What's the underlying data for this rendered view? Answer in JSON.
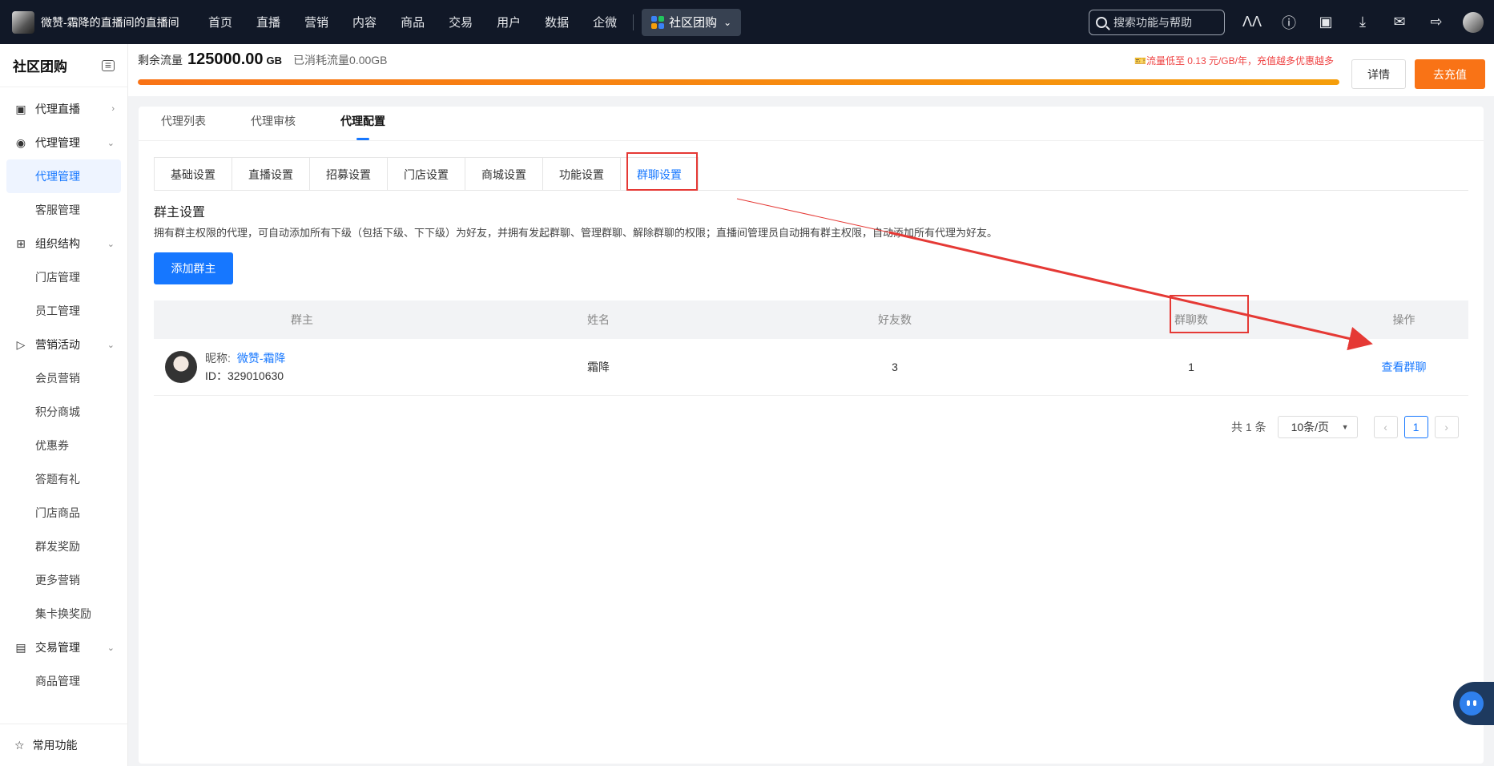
{
  "topbar": {
    "brand_name": "微赞-霜降的直播间的直播间",
    "nav": [
      "首页",
      "直播",
      "营销",
      "内容",
      "商品",
      "交易",
      "用户",
      "数据",
      "企微"
    ],
    "app_switch_label": "社区团购",
    "search_placeholder": "搜索功能与帮助"
  },
  "sidebar": {
    "title": "社区团购",
    "groups": [
      {
        "label": "代理直播",
        "icon": "calendar-icon",
        "arrow": "›",
        "items": []
      },
      {
        "label": "代理管理",
        "icon": "agent-icon",
        "arrow": "⌄",
        "items": [
          "代理管理",
          "客服管理"
        ]
      },
      {
        "label": "组织结构",
        "icon": "grid-icon",
        "arrow": "⌄",
        "items": [
          "门店管理",
          "员工管理"
        ]
      },
      {
        "label": "营销活动",
        "icon": "megaphone-icon",
        "arrow": "⌄",
        "items": [
          "会员营销",
          "积分商城",
          "优惠券",
          "答题有礼",
          "门店商品",
          "群发奖励",
          "更多营销",
          "集卡换奖励"
        ]
      },
      {
        "label": "交易管理",
        "icon": "wallet-icon",
        "arrow": "⌄",
        "items": [
          "商品管理"
        ]
      }
    ],
    "active_item": "代理管理",
    "footer_label": "常用功能"
  },
  "flow": {
    "label": "剩余流量",
    "value": "125000.00",
    "unit": "GB",
    "used": "已消耗流量0.00GB",
    "progress_percent": 100,
    "promo": "流量低至 0.13 元/GB/年，充值越多优惠越多",
    "detail_label": "详情",
    "recharge_label": "去充值"
  },
  "tabs": [
    "代理列表",
    "代理审核",
    "代理配置"
  ],
  "active_tab": "代理配置",
  "subtabs": [
    "基础设置",
    "直播设置",
    "招募设置",
    "门店设置",
    "商城设置",
    "功能设置",
    "群聊设置"
  ],
  "active_subtab": "群聊设置",
  "section": {
    "title": "群主设置",
    "desc": "拥有群主权限的代理，可自动添加所有下级（包括下级、下下级）为好友，并拥有发起群聊、管理群聊、解除群聊的权限；直播间管理员自动拥有群主权限，自动添加所有代理为好友。",
    "add_button": "添加群主"
  },
  "table": {
    "headers": [
      "群主",
      "姓名",
      "好友数",
      "群聊数",
      "操作"
    ],
    "rows": [
      {
        "nick_label": "昵称:",
        "nick": "微赞-霜降",
        "id_text": "ID：329010630",
        "name": "霜降",
        "friends": "3",
        "groups": "1",
        "action": "查看群聊"
      }
    ]
  },
  "pager": {
    "total": "共 1 条",
    "page_size": "10条/页",
    "current_page": "1"
  },
  "colors": {
    "primary": "#1677ff",
    "accent_orange": "#f97316",
    "annotation_red": "#e53935"
  }
}
